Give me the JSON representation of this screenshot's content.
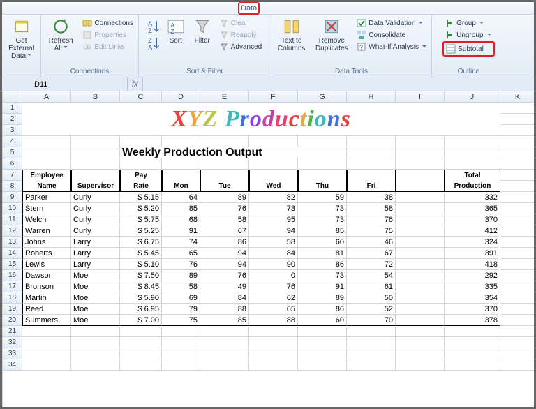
{
  "ribbon": {
    "active_tab": "Data",
    "groups": {
      "get_data": {
        "label": "Get External Data"
      },
      "connections": {
        "group_label": "Connections",
        "refresh": "Refresh All",
        "connections": "Connections",
        "properties": "Properties",
        "editlinks": "Edit Links"
      },
      "sortfilter": {
        "group_label": "Sort & Filter",
        "sort": "Sort",
        "filter": "Filter",
        "clear": "Clear",
        "reapply": "Reapply",
        "advanced": "Advanced"
      },
      "datatools": {
        "group_label": "Data Tools",
        "texttocols": "Text to Columns",
        "removedup": "Remove Duplicates",
        "validation": "Data Validation",
        "consolidate": "Consolidate",
        "whatif": "What-If Analysis"
      },
      "outline": {
        "group_label": "Outline",
        "group": "Group",
        "ungroup": "Ungroup",
        "subtotal": "Subtotal"
      }
    }
  },
  "formula_bar": {
    "namebox": "D11",
    "fx": "fx",
    "value": ""
  },
  "columns": [
    "A",
    "B",
    "C",
    "D",
    "E",
    "F",
    "G",
    "H",
    "I",
    "J",
    "K"
  ],
  "title": "XYZ Productions",
  "subtitle": "Weekly Production Output",
  "headers": {
    "employee": "Employee Name",
    "supervisor": "Supervisor",
    "payrate": "Pay Rate",
    "mon": "Mon",
    "tue": "Tue",
    "wed": "Wed",
    "thu": "Thu",
    "fri": "Fri",
    "total": "Total Production"
  },
  "chart_data": {
    "type": "table",
    "columns": [
      "Employee Name",
      "Supervisor",
      "Pay Rate",
      "Mon",
      "Tue",
      "Wed",
      "Thu",
      "Fri",
      "Total Production"
    ],
    "rows": [
      {
        "name": "Parker",
        "sup": "Curly",
        "rate": "$   5.15",
        "mon": 64,
        "tue": 89,
        "wed": 82,
        "thu": 59,
        "fri": 38,
        "tot": 332
      },
      {
        "name": "Stern",
        "sup": "Curly",
        "rate": "$   5.20",
        "mon": 85,
        "tue": 76,
        "wed": 73,
        "thu": 73,
        "fri": 58,
        "tot": 365
      },
      {
        "name": "Welch",
        "sup": "Curly",
        "rate": "$   5.75",
        "mon": 68,
        "tue": 58,
        "wed": 95,
        "thu": 73,
        "fri": 76,
        "tot": 370
      },
      {
        "name": "Warren",
        "sup": "Curly",
        "rate": "$   5.25",
        "mon": 91,
        "tue": 67,
        "wed": 94,
        "thu": 85,
        "fri": 75,
        "tot": 412
      },
      {
        "name": "Johns",
        "sup": "Larry",
        "rate": "$   6.75",
        "mon": 74,
        "tue": 86,
        "wed": 58,
        "thu": 60,
        "fri": 46,
        "tot": 324
      },
      {
        "name": "Roberts",
        "sup": "Larry",
        "rate": "$   5.45",
        "mon": 65,
        "tue": 94,
        "wed": 84,
        "thu": 81,
        "fri": 67,
        "tot": 391
      },
      {
        "name": "Lewis",
        "sup": "Larry",
        "rate": "$   5.10",
        "mon": 76,
        "tue": 94,
        "wed": 90,
        "thu": 86,
        "fri": 72,
        "tot": 418
      },
      {
        "name": "Dawson",
        "sup": "Moe",
        "rate": "$   7.50",
        "mon": 89,
        "tue": 76,
        "wed": 0,
        "thu": 73,
        "fri": 54,
        "tot": 292
      },
      {
        "name": "Bronson",
        "sup": "Moe",
        "rate": "$   8.45",
        "mon": 58,
        "tue": 49,
        "wed": 76,
        "thu": 91,
        "fri": 61,
        "tot": 335
      },
      {
        "name": "Martin",
        "sup": "Moe",
        "rate": "$   5.90",
        "mon": 69,
        "tue": 84,
        "wed": 62,
        "thu": 89,
        "fri": 50,
        "tot": 354
      },
      {
        "name": "Reed",
        "sup": "Moe",
        "rate": "$   6.95",
        "mon": 79,
        "tue": 88,
        "wed": 65,
        "thu": 86,
        "fri": 52,
        "tot": 370
      },
      {
        "name": "Summers",
        "sup": "Moe",
        "rate": "$   7.00",
        "mon": 75,
        "tue": 85,
        "wed": 88,
        "thu": 60,
        "fri": 70,
        "tot": 378
      }
    ]
  },
  "visible_rows": [
    1,
    2,
    3,
    4,
    5,
    6,
    7,
    8,
    9,
    10,
    11,
    12,
    13,
    14,
    15,
    16,
    17,
    18,
    19,
    20,
    21,
    32,
    33,
    34
  ]
}
